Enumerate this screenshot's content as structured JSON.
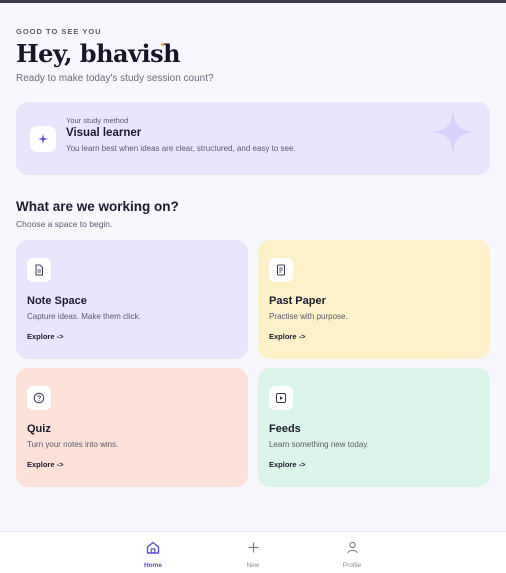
{
  "header": {
    "eyebrow": "GOOD TO SEE YOU",
    "greeting": "Hey, bhavish",
    "subtitle": "Ready to make today's study session count?"
  },
  "study_method": {
    "label": "Your study method",
    "name": "Visual learner",
    "description": "You learn best when ideas are clear, structured, and easy to see.",
    "icon": "sparkle-icon"
  },
  "section": {
    "title": "What are we working on?",
    "subtitle": "Choose a space to begin."
  },
  "spaces": [
    {
      "title": "Note Space",
      "description": "Capture ideas. Make them click.",
      "link": "Explore ->",
      "icon": "document-icon",
      "color": "#e8e6fd"
    },
    {
      "title": "Past Paper",
      "description": "Practise with purpose.",
      "link": "Explore ->",
      "icon": "paper-icon",
      "color": "#fdf1c9"
    },
    {
      "title": "Quiz",
      "description": "Turn your notes into wins.",
      "link": "Explore ->",
      "icon": "quiz-icon",
      "color": "#fde2da"
    },
    {
      "title": "Feeds",
      "description": "Learn something new today.",
      "link": "Explore ->",
      "icon": "play-icon",
      "color": "#dcf5ea"
    }
  ],
  "nav": {
    "items": [
      {
        "label": "Home",
        "icon": "home-icon",
        "active": true
      },
      {
        "label": "New",
        "icon": "plus-icon",
        "active": false
      },
      {
        "label": "Profile",
        "icon": "user-icon",
        "active": false
      }
    ]
  },
  "colors": {
    "accent": "#5a4fd0",
    "greeting_dot": "#f4a24a"
  }
}
